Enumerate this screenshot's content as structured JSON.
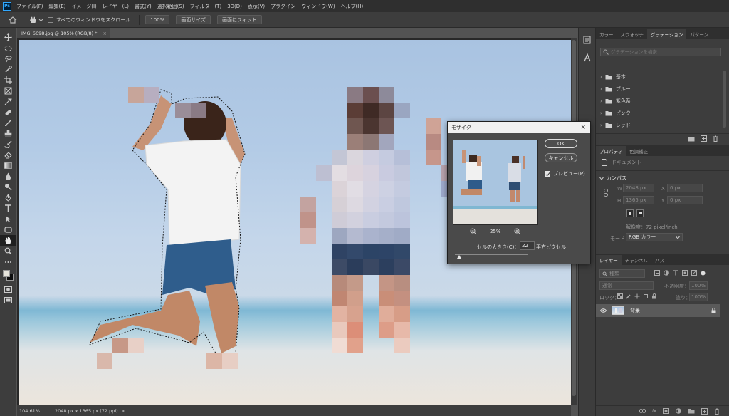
{
  "app": {
    "logo_text": "Ps",
    "menu": [
      "ファイル(F)",
      "編集(E)",
      "イメージ(I)",
      "レイヤー(L)",
      "書式(Y)",
      "選択範囲(S)",
      "フィルター(T)",
      "3D(D)",
      "表示(V)",
      "プラグイン",
      "ウィンドウ(W)",
      "ヘルプ(H)"
    ]
  },
  "options": {
    "scroll_all_label": "すべてのウィンドウをスクロール",
    "zoom_100": "100%",
    "actual_size": "画面サイズ",
    "fit_screen": "画面にフィット"
  },
  "document": {
    "tab_title": "IMG_6698.jpg @ 105% (RGB/8) *",
    "tab_close": "×",
    "zoom": "104.61%",
    "info": "2048 px x 1365 px (72 ppi)"
  },
  "gradient_panel": {
    "tabs": [
      "カラー",
      "スウォッチ",
      "グラデーション",
      "パターン"
    ],
    "active_tab": "グラデーション",
    "search_placeholder": "グラデーションを検索",
    "folders": [
      "基本",
      "ブルー",
      "紫色系",
      "ピンク",
      "レッド"
    ]
  },
  "properties_panel": {
    "tabs": [
      "プロパティ",
      "色調補正"
    ],
    "doc_label": "ドキュメント",
    "section": "カンバス",
    "w_label": "W",
    "w_value": "2048 px",
    "x_label": "X",
    "x_value": "0 px",
    "h_label": "H",
    "h_value": "1365 px",
    "y_label": "Y",
    "y_value": "0 px",
    "resolution": "解像度：72 pixel/inch",
    "mode_label": "モード",
    "mode_value": "RGB カラー"
  },
  "layers_panel": {
    "tabs": [
      "レイヤー",
      "チャンネル",
      "パス"
    ],
    "kind_filter": "種類",
    "blend_mode": "通常",
    "opacity_label": "不透明度：",
    "opacity_value": "100%",
    "lock_label": "ロック：",
    "fill_label": "塗り：",
    "fill_value": "100%",
    "layer_name": "背景"
  },
  "mosaic_dialog": {
    "title": "モザイク",
    "close": "×",
    "ok": "OK",
    "cancel": "キャンセル",
    "preview_label": "プレビュー(P)",
    "preview_checked": true,
    "zoom": "25%",
    "cell_size_label": "セルの大きさ(C)：",
    "cell_size_value": "22",
    "unit": "平方ピクセル",
    "slider_level": 0.06
  }
}
